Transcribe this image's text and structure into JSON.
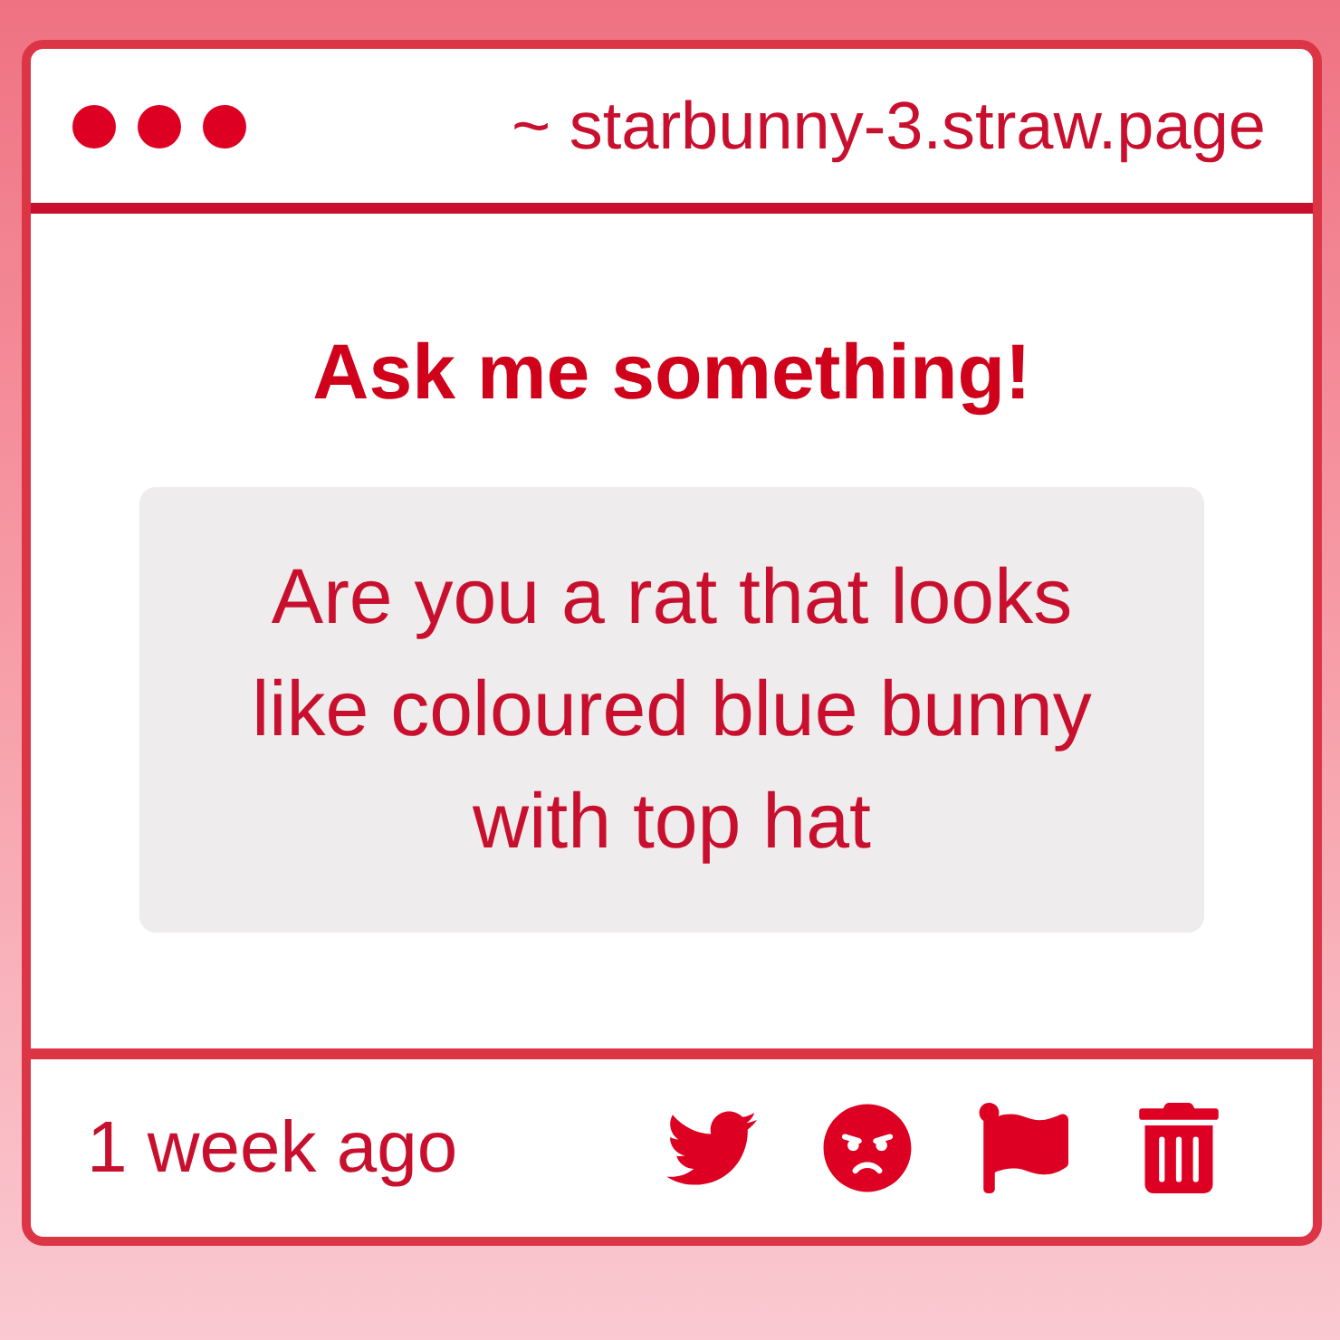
{
  "header": {
    "url": "~ starbunny-3.straw.page"
  },
  "prompt": {
    "title": "Ask me something!",
    "question": "Are you a rat that looks like coloured blue bunny with top hat"
  },
  "footer": {
    "time": "1 week ago"
  }
}
